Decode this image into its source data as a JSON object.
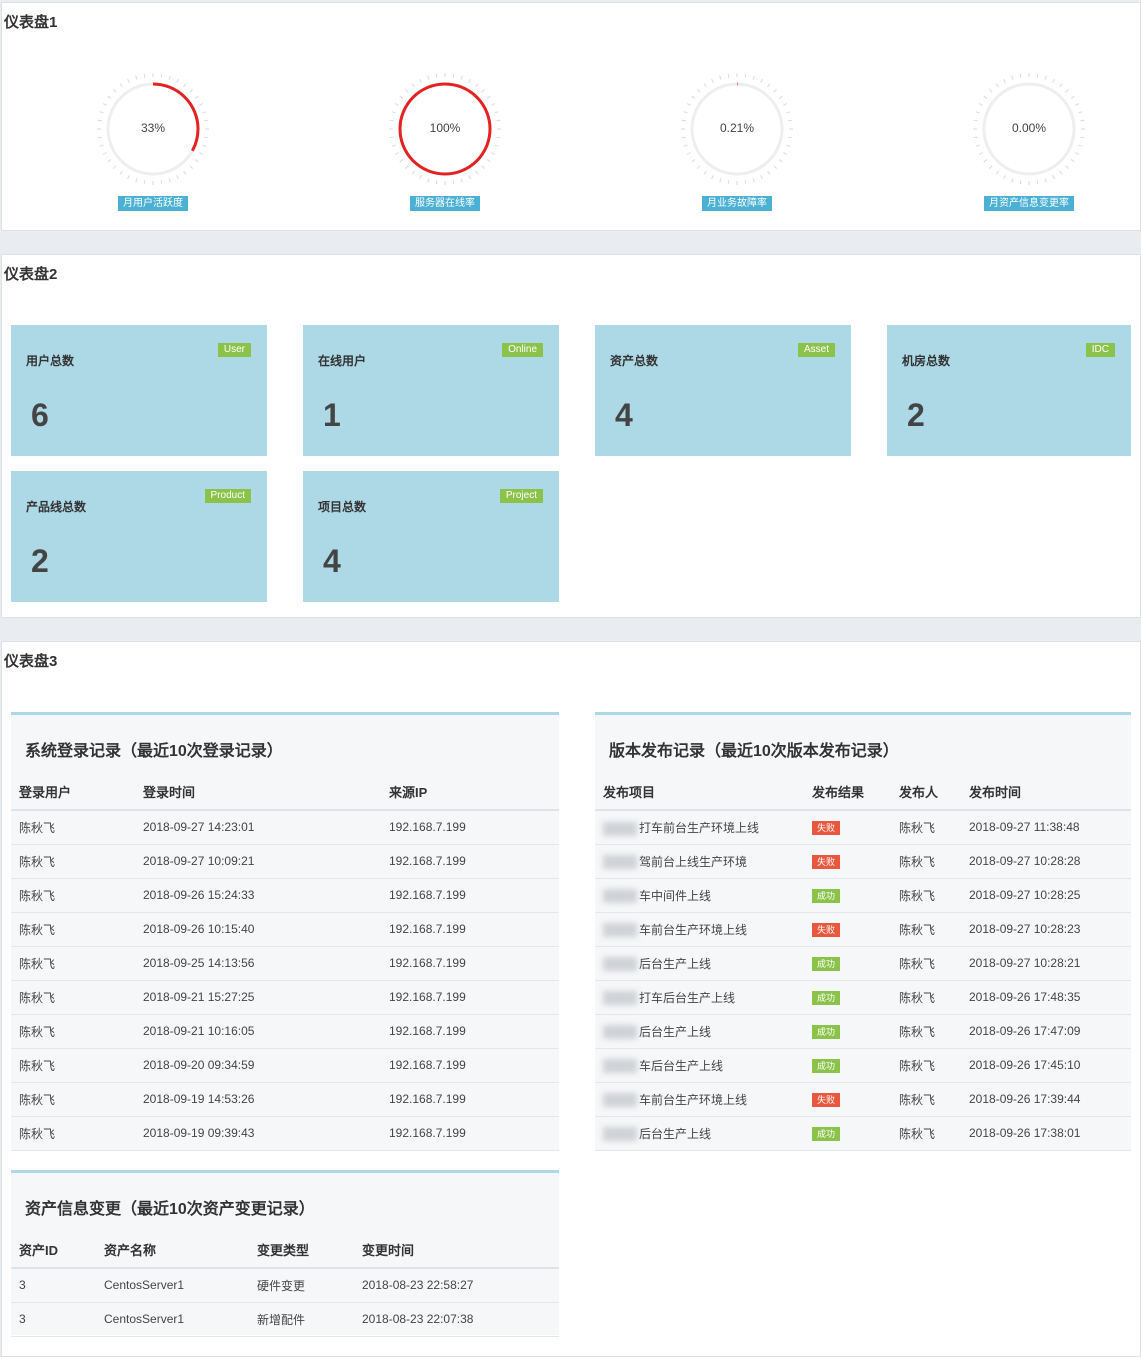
{
  "panel1": {
    "title": "仪表盘1",
    "gauges": [
      {
        "value_text": "33%",
        "fraction": 0.33,
        "label": "月用户活跃度",
        "color": "#e32222"
      },
      {
        "value_text": "100%",
        "fraction": 1.0,
        "label": "服务器在线率",
        "color": "#e32222"
      },
      {
        "value_text": "0.21%",
        "fraction": 0.0021,
        "label": "月业务故障率",
        "color": "#e32222"
      },
      {
        "value_text": "0.00%",
        "fraction": 0.0,
        "label": "月资产信息变更率",
        "color": "#e32222"
      }
    ]
  },
  "panel2": {
    "title": "仪表盘2",
    "cards": [
      {
        "title": "用户总数",
        "badge": "User",
        "value": "6"
      },
      {
        "title": "在线用户",
        "badge": "Online",
        "value": "1"
      },
      {
        "title": "资产总数",
        "badge": "Asset",
        "value": "4"
      },
      {
        "title": "机房总数",
        "badge": "IDC",
        "value": "2"
      },
      {
        "title": "产品线总数",
        "badge": "Product",
        "value": "2"
      },
      {
        "title": "项目总数",
        "badge": "Project",
        "value": "4"
      }
    ]
  },
  "panel3": {
    "title": "仪表盘3",
    "login": {
      "title": "系统登录记录（最近10次登录记录）",
      "headers": [
        "登录用户",
        "登录时间",
        "来源IP"
      ],
      "rows": [
        [
          "陈秋飞",
          "2018-09-27 14:23:01",
          "192.168.7.199"
        ],
        [
          "陈秋飞",
          "2018-09-27 10:09:21",
          "192.168.7.199"
        ],
        [
          "陈秋飞",
          "2018-09-26 15:24:33",
          "192.168.7.199"
        ],
        [
          "陈秋飞",
          "2018-09-26 10:15:40",
          "192.168.7.199"
        ],
        [
          "陈秋飞",
          "2018-09-25 14:13:56",
          "192.168.7.199"
        ],
        [
          "陈秋飞",
          "2018-09-21 15:27:25",
          "192.168.7.199"
        ],
        [
          "陈秋飞",
          "2018-09-21 10:16:05",
          "192.168.7.199"
        ],
        [
          "陈秋飞",
          "2018-09-20 09:34:59",
          "192.168.7.199"
        ],
        [
          "陈秋飞",
          "2018-09-19 14:53:26",
          "192.168.7.199"
        ],
        [
          "陈秋飞",
          "2018-09-19 09:39:43",
          "192.168.7.199"
        ]
      ]
    },
    "release": {
      "title": "版本发布记录（最近10次版本发布记录）",
      "headers": [
        "发布项目",
        "发布结果",
        "发布人",
        "发布时间"
      ],
      "rows": [
        {
          "project": "打车前台生产环境上线",
          "result": "失败",
          "status": "fail",
          "user": "陈秋飞",
          "time": "2018-09-27 11:38:48"
        },
        {
          "project": "驾前台上线生产环境",
          "result": "失败",
          "status": "fail",
          "user": "陈秋飞",
          "time": "2018-09-27 10:28:28"
        },
        {
          "project": "车中间件上线",
          "result": "成功",
          "status": "ok",
          "user": "陈秋飞",
          "time": "2018-09-27 10:28:25"
        },
        {
          "project": "车前台生产环境上线",
          "result": "失败",
          "status": "fail",
          "user": "陈秋飞",
          "time": "2018-09-27 10:28:23"
        },
        {
          "project": "后台生产上线",
          "result": "成功",
          "status": "ok",
          "user": "陈秋飞",
          "time": "2018-09-27 10:28:21"
        },
        {
          "project": "打车后台生产上线",
          "result": "成功",
          "status": "ok",
          "user": "陈秋飞",
          "time": "2018-09-26 17:48:35"
        },
        {
          "project": "后台生产上线",
          "result": "成功",
          "status": "ok",
          "user": "陈秋飞",
          "time": "2018-09-26 17:47:09"
        },
        {
          "project": "车后台生产上线",
          "result": "成功",
          "status": "ok",
          "user": "陈秋飞",
          "time": "2018-09-26 17:45:10"
        },
        {
          "project": "车前台生产环境上线",
          "result": "失败",
          "status": "fail",
          "user": "陈秋飞",
          "time": "2018-09-26 17:39:44"
        },
        {
          "project": "后台生产上线",
          "result": "成功",
          "status": "ok",
          "user": "陈秋飞",
          "time": "2018-09-26 17:38:01"
        }
      ]
    },
    "asset": {
      "title": "资产信息变更（最近10次资产变更记录）",
      "headers": [
        "资产ID",
        "资产名称",
        "变更类型",
        "变更时间"
      ],
      "rows": [
        [
          "3",
          "CentosServer1",
          "硬件变更",
          "2018-08-23 22:58:27"
        ],
        [
          "3",
          "CentosServer1",
          "新增配件",
          "2018-08-23 22:07:38"
        ]
      ]
    }
  }
}
